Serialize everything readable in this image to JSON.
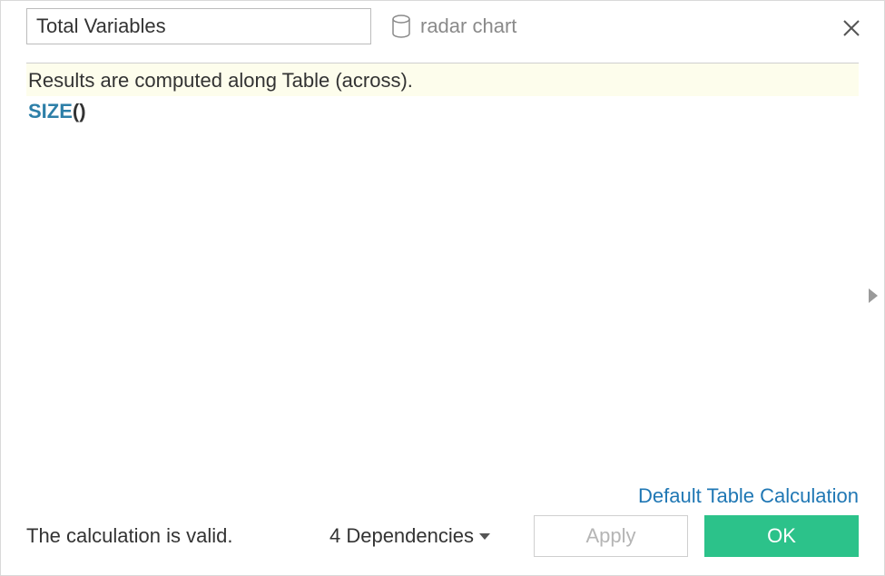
{
  "header": {
    "name_value": "Total Variables",
    "datasource_label": "radar chart"
  },
  "hint": "Results are computed along Table (across).",
  "formula": {
    "function": "SIZE",
    "args": ""
  },
  "link": {
    "default_table_calc": "Default Table Calculation"
  },
  "footer": {
    "status": "The calculation is valid.",
    "dependencies_label": "4 Dependencies",
    "apply_label": "Apply",
    "ok_label": "OK"
  }
}
